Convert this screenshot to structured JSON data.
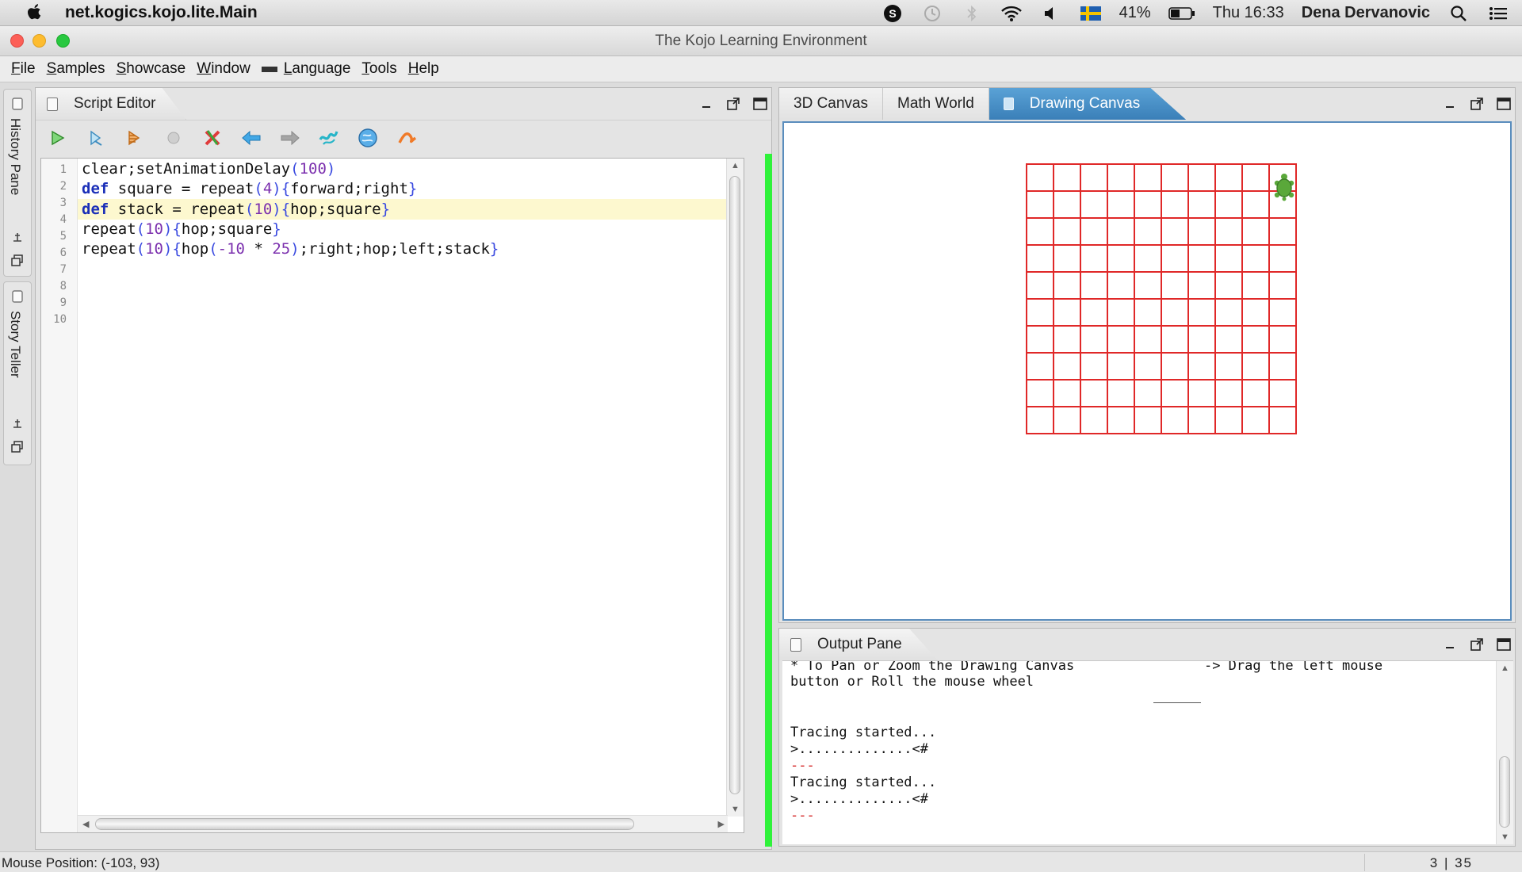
{
  "menubar": {
    "app_name": "net.kogics.kojo.lite.Main",
    "battery": "41%",
    "clock": "Thu 16:33",
    "user": "Dena Dervanovic"
  },
  "window": {
    "title": "The Kojo Learning Environment"
  },
  "app_menu": [
    "File",
    "Samples",
    "Showcase",
    "Window",
    "Language",
    "Tools",
    "Help"
  ],
  "sidebar": {
    "history_label": "History Pane",
    "story_label": "Story Teller"
  },
  "editor": {
    "tab_label": "Script Editor",
    "line_numbers": [
      "1",
      "2",
      "3",
      "4",
      "5",
      "6",
      "7",
      "8",
      "9",
      "10"
    ],
    "current_line": 3
  },
  "canvas": {
    "tabs": [
      "3D Canvas",
      "Math World",
      "Drawing Canvas"
    ],
    "active_tab": "Drawing Canvas",
    "grid": {
      "rows": 10,
      "cols": 10,
      "color": "#e02828"
    },
    "turtle": {
      "row": 0,
      "col": 9,
      "color": "#5aa83a"
    }
  },
  "output": {
    "tab_label": "Output Pane",
    "lines": [
      {
        "text": "* To Pan or Zoom the Drawing Canvas                -> Drag the left mouse",
        "color": "black"
      },
      {
        "text": "button or Roll the mouse wheel",
        "color": "black"
      },
      {
        "text": "Tracing started...",
        "color": "black"
      },
      {
        "text": ">..............<#",
        "color": "black"
      },
      {
        "text": "---",
        "color": "red"
      },
      {
        "text": "Tracing started...",
        "color": "black"
      },
      {
        "text": ">..............<#",
        "color": "black"
      },
      {
        "text": "---",
        "color": "red"
      }
    ]
  },
  "status": {
    "mouse_position": "Mouse Position: (-103, 93)",
    "caret": "3 | 35"
  },
  "colors": {
    "accent_tab": "#3a7fb8",
    "run_strip": "#2ff23a",
    "highlight_line": "#fdf8cf"
  }
}
